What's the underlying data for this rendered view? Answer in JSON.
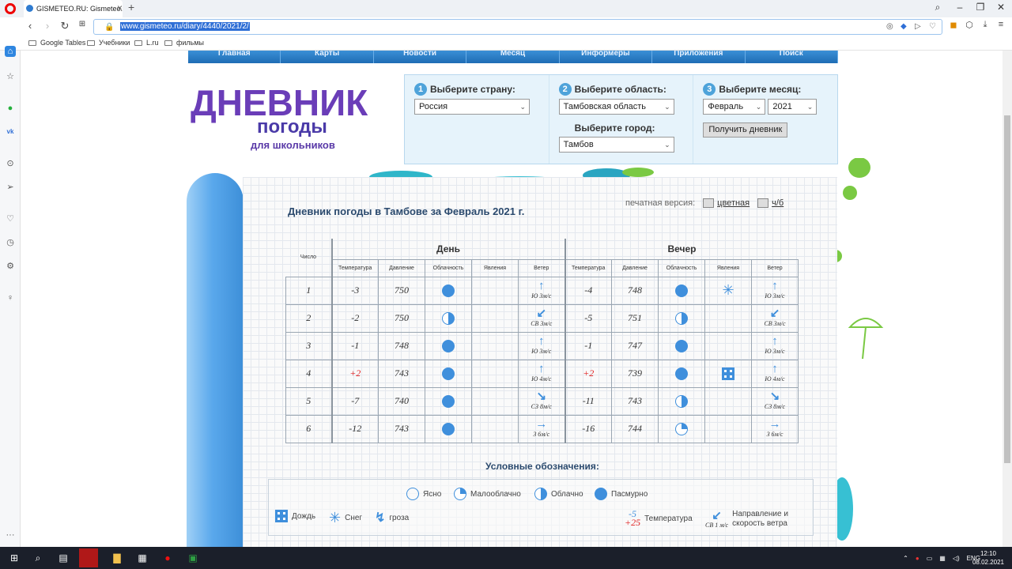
{
  "browser": {
    "tab_title": "GISMETEO.RU: Gismeteo.Д",
    "url": "www.gismeteo.ru/diary/4440/2021/2/",
    "bookmarks": [
      "Google Tables",
      "Учебники",
      "L.ru",
      "фильмы"
    ]
  },
  "site_nav": [
    "Главная",
    "Карты",
    "Новости",
    "Месяц",
    "Информеры",
    "Приложения",
    "Поиск"
  ],
  "logo": {
    "line1": "ДНЕВНИК",
    "line2": "погоды",
    "line3": "для школьников"
  },
  "selector": {
    "country_label": "Выберите страну:",
    "country": "Россия",
    "region_label": "Выберите область:",
    "region": "Тамбовская область",
    "city_label": "Выберите город:",
    "city": "Тамбов",
    "month_label": "Выберите месяц:",
    "month": "Февраль",
    "year": "2021",
    "button": "Получить дневник"
  },
  "diary": {
    "title": "Дневник погоды в Тамбове за Февраль 2021 г.",
    "print_label": "печатная версия:",
    "color": "цветная",
    "bw": "ч/б"
  },
  "table": {
    "day": "День",
    "evening": "Вечер",
    "number": "Число",
    "cols": [
      "Температура",
      "Давление",
      "Облачность",
      "Явления",
      "Ветер"
    ],
    "rows": [
      {
        "n": "1",
        "dt": "-3",
        "dp": "750",
        "dc": "p",
        "dph": "",
        "dw": "Ю 3м/с",
        "dwa": "↑",
        "et": "-4",
        "ep": "748",
        "ec": "p",
        "eph": "snow",
        "ew": "Ю 3м/с",
        "ewa": "↑"
      },
      {
        "n": "2",
        "dt": "-2",
        "dp": "750",
        "dc": "o",
        "dph": "",
        "dw": "СВ 3м/с",
        "dwa": "↙",
        "et": "-5",
        "ep": "751",
        "ec": "o",
        "eph": "",
        "ew": "СВ 3м/с",
        "ewa": "↙"
      },
      {
        "n": "3",
        "dt": "-1",
        "dp": "748",
        "dc": "p",
        "dph": "",
        "dw": "Ю 3м/с",
        "dwa": "↑",
        "et": "-1",
        "ep": "747",
        "ec": "p",
        "eph": "",
        "ew": "Ю 3м/с",
        "ewa": "↑"
      },
      {
        "n": "4",
        "dt": "+2",
        "dp": "743",
        "dc": "p",
        "dph": "",
        "dw": "Ю 4м/с",
        "dwa": "↑",
        "et": "+2",
        "ep": "739",
        "ec": "p",
        "eph": "rain",
        "ew": "Ю 4м/с",
        "ewa": "↑"
      },
      {
        "n": "5",
        "dt": "-7",
        "dp": "740",
        "dc": "p",
        "dph": "",
        "dw": "СЗ 8м/с",
        "dwa": "↘",
        "et": "-11",
        "ep": "743",
        "ec": "o",
        "eph": "",
        "ew": "СЗ 8м/с",
        "ewa": "↘"
      },
      {
        "n": "6",
        "dt": "-12",
        "dp": "743",
        "dc": "p",
        "dph": "",
        "dw": "З 6м/с",
        "dwa": "→",
        "et": "-16",
        "ep": "744",
        "ec": "m",
        "eph": "",
        "ew": "З 6м/с",
        "ewa": "→"
      }
    ]
  },
  "legend": {
    "title": "Условные обозначения:",
    "clear": "Ясно",
    "partly": "Малооблачно",
    "cloudy": "Облачно",
    "overcast": "Пасмурно",
    "rain": "Дождь",
    "snow": "Снег",
    "storm": "гроза",
    "temp_label": "Температура",
    "temp_cold": "-5",
    "temp_warm": "+25",
    "wind_label": "Направление и скорость ветра",
    "wind_sample": "СВ 1 м/с"
  },
  "taskbar": {
    "lang": "ENG",
    "time": "12:10",
    "date": "08.02.2021"
  },
  "colors": {
    "accent": "#3f8fdc",
    "warm": "#e02020",
    "title": "#2b4a6e"
  }
}
